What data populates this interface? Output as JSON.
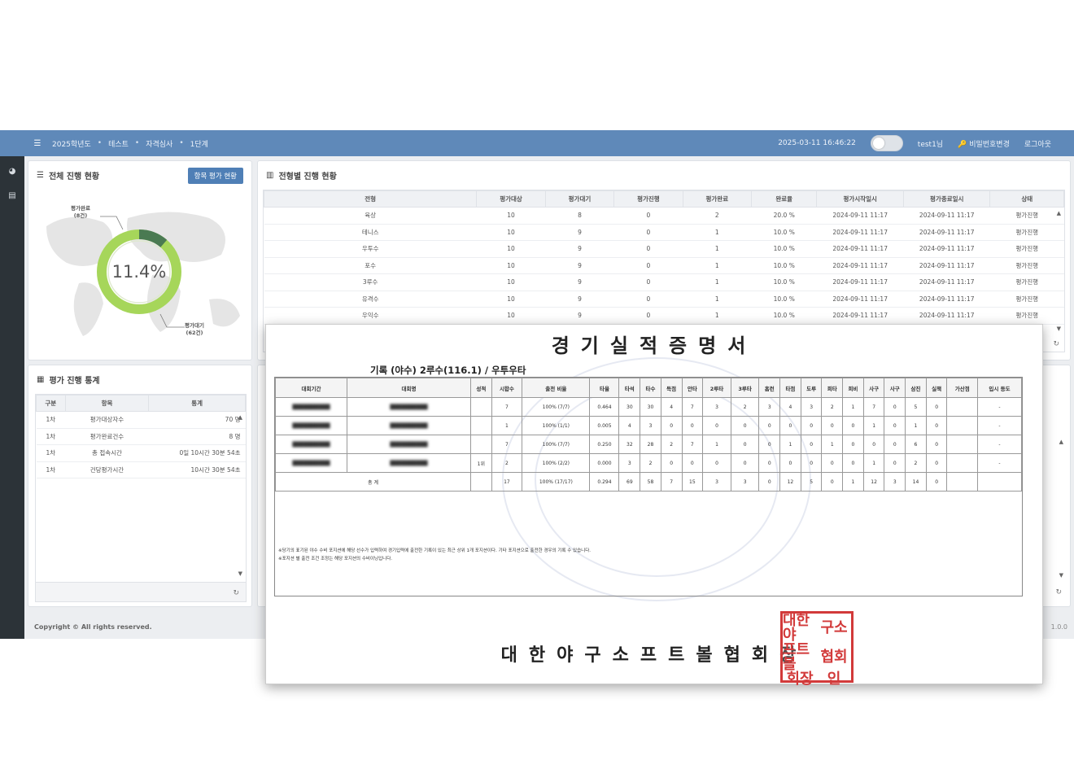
{
  "header": {
    "breadcrumb": [
      "2025학년도",
      "테스트",
      "자격심사",
      "1단계"
    ],
    "datetime": "2025-03-11 16:46:22",
    "user": "test1님",
    "change_password": "비밀번호변경",
    "logout": "로그아웃"
  },
  "overall": {
    "title": "전체 진행 현황",
    "button": "항목 평가 현황",
    "percent": "11.4%",
    "percent_value": 11.4,
    "label_done": [
      "평가완료",
      "(8건)"
    ],
    "label_wait": [
      "평가대기",
      "(62건)"
    ]
  },
  "progress": {
    "title": "전형별 진행 현황",
    "columns": [
      "전형",
      "평가대상",
      "평가대기",
      "평가진행",
      "평가완료",
      "완료율",
      "평가시작일시",
      "평가종료일시",
      "상태"
    ],
    "rows": [
      [
        "육상",
        "10",
        "8",
        "0",
        "2",
        "20.0 %",
        "2024-09-11 11:17",
        "2024-09-11 11:17",
        "평가진행"
      ],
      [
        "테니스",
        "10",
        "9",
        "0",
        "1",
        "10.0 %",
        "2024-09-11 11:17",
        "2024-09-11 11:17",
        "평가진행"
      ],
      [
        "우투수",
        "10",
        "9",
        "0",
        "1",
        "10.0 %",
        "2024-09-11 11:17",
        "2024-09-11 11:17",
        "평가진행"
      ],
      [
        "포수",
        "10",
        "9",
        "0",
        "1",
        "10.0 %",
        "2024-09-11 11:17",
        "2024-09-11 11:17",
        "평가진행"
      ],
      [
        "3루수",
        "10",
        "9",
        "0",
        "1",
        "10.0 %",
        "2024-09-11 11:17",
        "2024-09-11 11:17",
        "평가진행"
      ],
      [
        "유격수",
        "10",
        "9",
        "0",
        "1",
        "10.0 %",
        "2024-09-11 11:17",
        "2024-09-11 11:17",
        "평가진행"
      ],
      [
        "우익수",
        "10",
        "9",
        "0",
        "1",
        "10.0 %",
        "2024-09-11 11:17",
        "2024-09-11 11:17",
        "평가진행"
      ]
    ]
  },
  "stats": {
    "title": "평가 진행 통계",
    "columns": [
      "구분",
      "항목",
      "통계"
    ],
    "rows": [
      [
        "1차",
        "평가대상자수",
        "70 명"
      ],
      [
        "1차",
        "평가완료건수",
        "8 명"
      ],
      [
        "1차",
        "총 접속시간",
        "0일 10시간 30분 54초"
      ],
      [
        "1차",
        "건당평가시간",
        "10시간 30분 54초"
      ]
    ]
  },
  "footer": {
    "copyright": "Copyright © All rights reserved.",
    "version": "1.0.0"
  },
  "document": {
    "title": "경기실적증명서",
    "subtitle": "기록 (야수) 2루수(116.1) / 우투우타",
    "columns": [
      "대회기간",
      "대회명",
      "성적",
      "시합수",
      "출전\n비율",
      "타율",
      "타석",
      "타수",
      "득점",
      "안타",
      "2루타",
      "3루타",
      "홈런",
      "타점",
      "도루",
      "희타",
      "희비",
      "사구",
      "사구",
      "삼진",
      "실책",
      "가산점",
      "입시\n등도"
    ],
    "rows": [
      [
        "",
        "",
        "",
        "7",
        "100%\n(7/7)",
        "0.464",
        "30",
        "30",
        "4",
        "7",
        "3",
        "2",
        "3",
        "4",
        "3",
        "2",
        "1",
        "7",
        "0",
        "5",
        "0",
        "",
        "-"
      ],
      [
        "",
        "",
        "",
        "1",
        "100%\n(1/1)",
        "0.005",
        "4",
        "3",
        "0",
        "0",
        "0",
        "0",
        "0",
        "0",
        "0",
        "0",
        "0",
        "1",
        "0",
        "1",
        "0",
        "",
        "-"
      ],
      [
        "",
        "",
        "",
        "7",
        "100%\n(7/7)",
        "0.250",
        "32",
        "28",
        "2",
        "7",
        "1",
        "0",
        "0",
        "1",
        "0",
        "1",
        "0",
        "0",
        "0",
        "6",
        "0",
        "",
        "-"
      ],
      [
        "",
        "",
        "1위",
        "2",
        "100%\n(2/2)",
        "0.000",
        "3",
        "2",
        "0",
        "0",
        "0",
        "0",
        "0",
        "0",
        "0",
        "0",
        "0",
        "1",
        "0",
        "2",
        "0",
        "",
        "-"
      ]
    ],
    "total": [
      "총 계",
      "",
      "17",
      "100%\n(17/17)",
      "0.294",
      "69",
      "58",
      "7",
      "15",
      "3",
      "3",
      "0",
      "12",
      "5",
      "0",
      "1",
      "12",
      "3",
      "14",
      "0",
      "",
      ""
    ],
    "notes": [
      "※당기의 표기된 야수 수비 포지션에 해당 선수가 입력하여 경기입력에 출전한 기록이 있는 최근 상위 1개 포지션이다. 기타 포지션으로 출전한 경우의 기록 수 있습니다.",
      "※포지션 별 출전 조건 조정는 해당 포지션의 수비이닝입니다."
    ],
    "issuer": "대한야구소프트볼협회장",
    "seal_chars": [
      "대한야",
      "구소",
      "프트볼",
      "협회",
      "회장",
      "인"
    ]
  }
}
